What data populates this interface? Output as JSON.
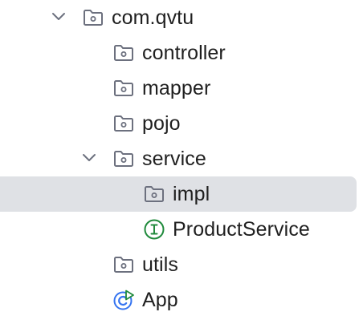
{
  "tree": {
    "root": {
      "label": "com.qvtu",
      "icon": "package-folder-icon",
      "expanded": true
    },
    "children": [
      {
        "label": "controller",
        "icon": "package-folder-icon"
      },
      {
        "label": "mapper",
        "icon": "package-folder-icon"
      },
      {
        "label": "pojo",
        "icon": "package-folder-icon"
      },
      {
        "label": "service",
        "icon": "package-folder-icon",
        "expanded": true
      },
      {
        "label": "impl",
        "icon": "package-folder-icon",
        "selected": true
      },
      {
        "label": "ProductService",
        "icon": "interface-icon"
      },
      {
        "label": "utils",
        "icon": "package-folder-icon"
      },
      {
        "label": "App",
        "icon": "spring-boot-app-icon"
      }
    ]
  },
  "colors": {
    "selection_bg": "#dfe1e5",
    "icon_stroke": "#6c707e",
    "interface_green": "#208a3c",
    "app_blue": "#3574f0",
    "app_green": "#208a3c"
  }
}
